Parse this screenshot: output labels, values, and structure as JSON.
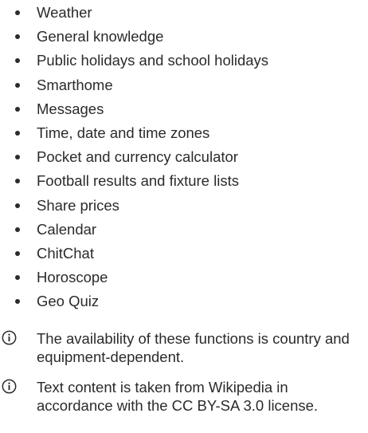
{
  "features": [
    "Weather",
    "General knowledge",
    "Public holidays and school holidays",
    "Smarthome",
    "Messages",
    "Time, date and time zones",
    "Pocket and currency calculator",
    "Football results and fixture lists",
    "Share prices",
    "Calendar",
    "ChitChat",
    "Horoscope",
    "Geo Quiz"
  ],
  "notes": [
    {
      "icon": "info-icon",
      "text": "The availability of these functions is country and equipment-dependent."
    },
    {
      "icon": "info-icon",
      "text": "Text content is taken from Wikipedia in accordance with the CC BY-SA 3.0 license."
    }
  ],
  "colors": {
    "text": "#2b2b2b",
    "icon": "#2b2b2b",
    "background": "#ffffff"
  }
}
